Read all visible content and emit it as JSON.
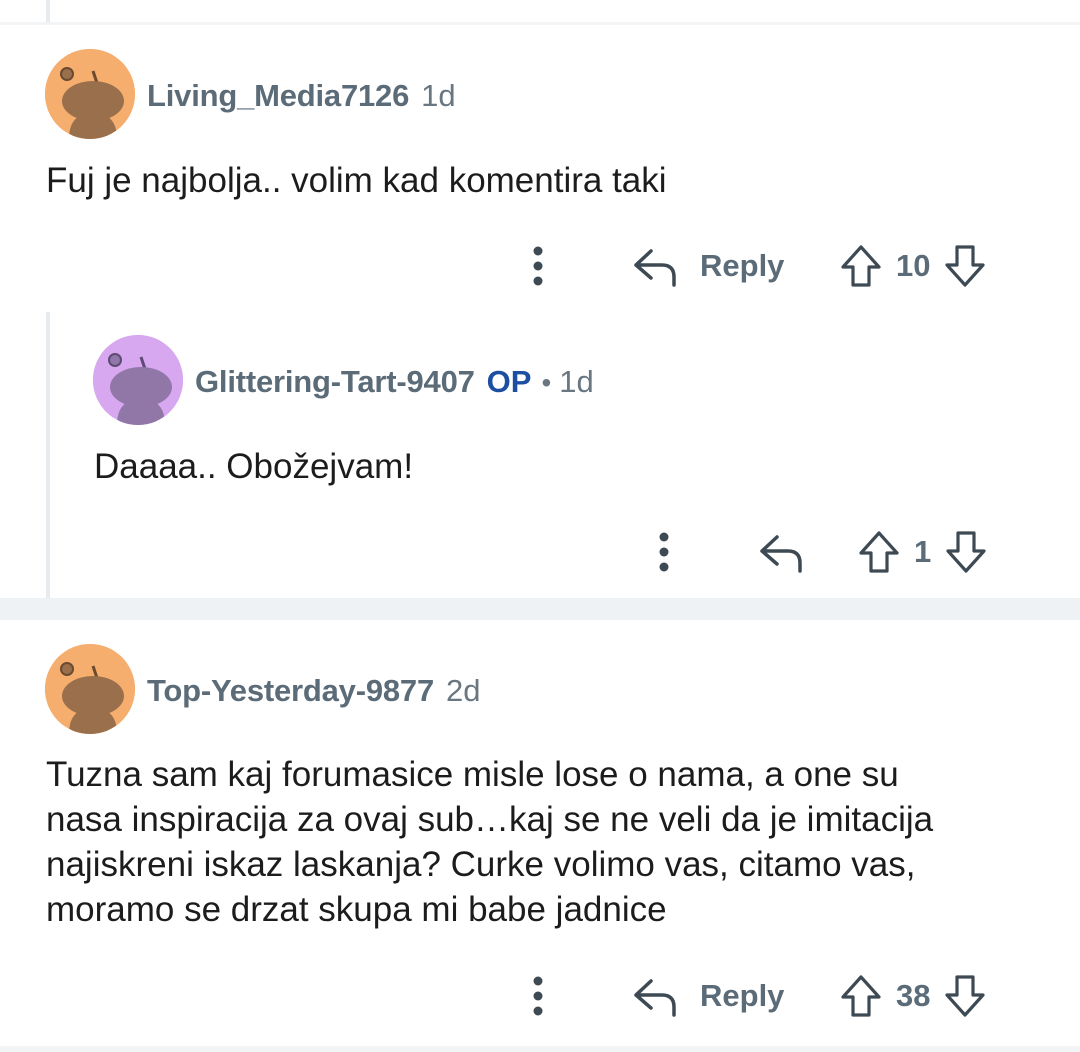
{
  "comments": [
    {
      "username": "Living_Media7126",
      "time": "1d",
      "body": "Fuj je najbolja.. volim kad komentira taki",
      "reply_label": "Reply",
      "score": "10",
      "avatar_color": "#f5ae6e"
    },
    {
      "username": "Glittering-Tart-9407",
      "op_badge": "OP",
      "separator": "•",
      "time": "1d",
      "body": "Daaaa.. Obožejvam!",
      "score": "1",
      "avatar_color": "#d7a7ef"
    },
    {
      "username": "Top-Yesterday-9877",
      "time": "2d",
      "body_lines": [
        "Tuzna sam kaj forumasice misle lose o nama, a one su",
        "nasa inspiracija za ovaj sub…kaj se ne veli da je imitacija",
        "najiskreni iskaz laskanja? Curke volimo vas, citamo vas,",
        "moramo se drzat skupa mi babe jadnice"
      ],
      "reply_label": "Reply",
      "score": "38",
      "avatar_color": "#f5ae6e"
    }
  ],
  "icons": {
    "more": "more-vertical-icon",
    "reply": "reply-arrow-icon",
    "upvote": "upvote-arrow-icon",
    "downvote": "downvote-arrow-icon"
  },
  "colors": {
    "op_badge": "#1c4fa1",
    "meta_text": "#5b6b78"
  }
}
